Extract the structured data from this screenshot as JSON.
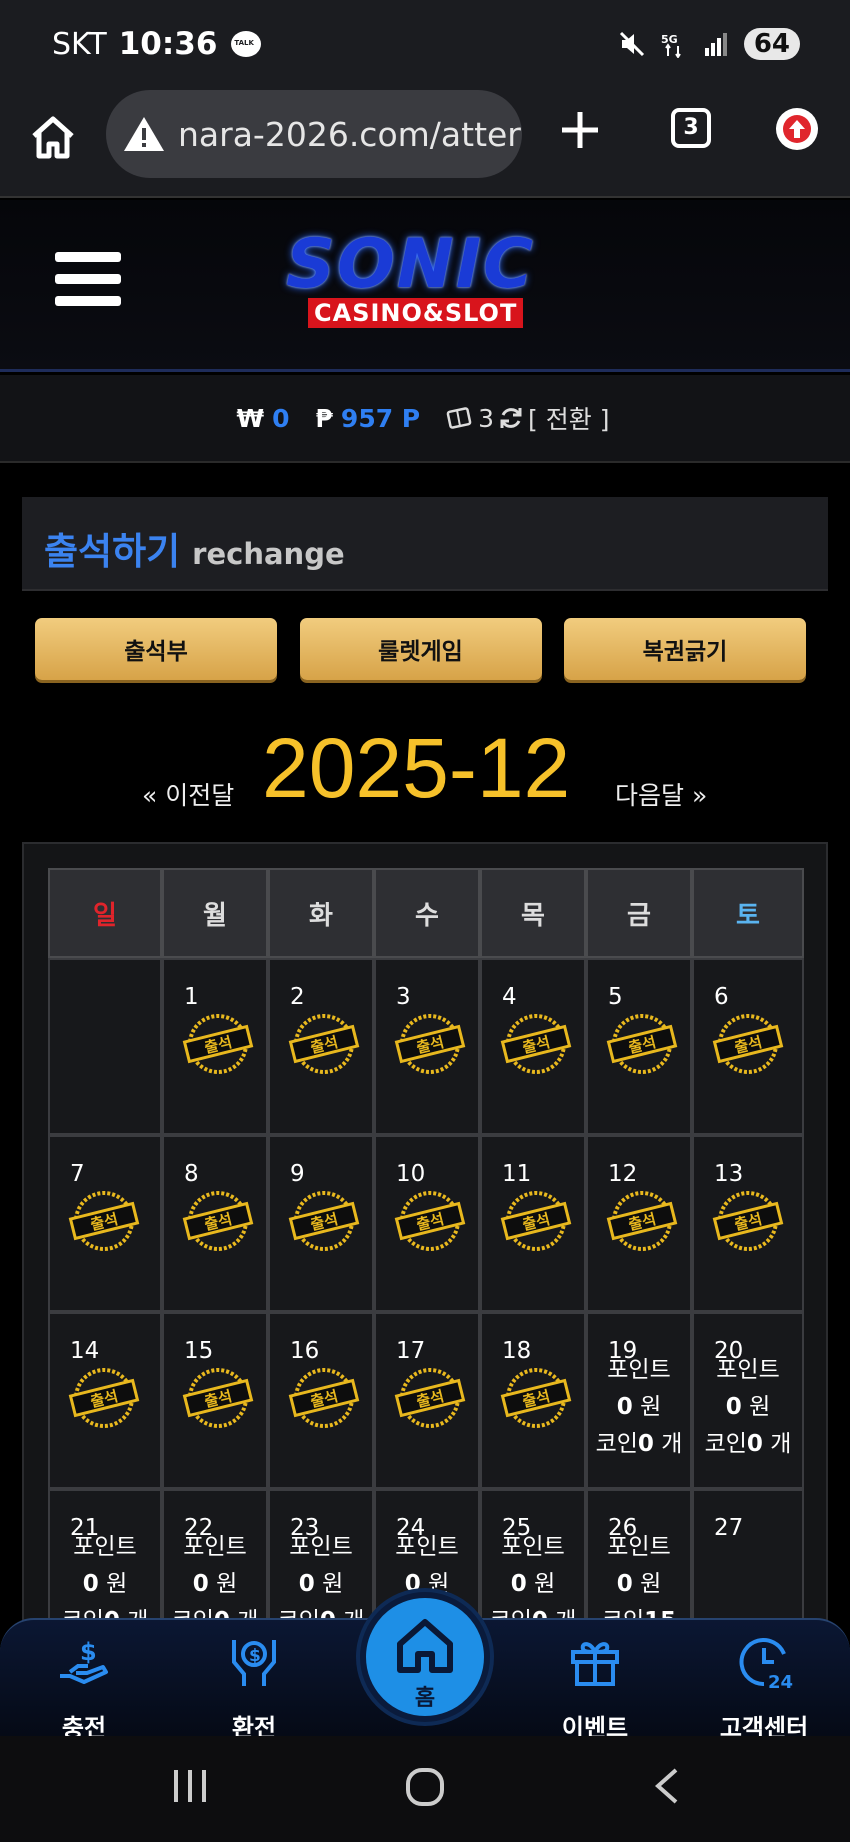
{
  "status_bar": {
    "carrier": "SKT",
    "time": "10:36",
    "battery": "64",
    "network": "5G"
  },
  "browser": {
    "url": "nara-2026.com/atter",
    "tab_count": "3"
  },
  "site": {
    "logo_main": "SONIC",
    "logo_sub": "CASINO&SLOT"
  },
  "balance": {
    "won_symbol": "₩",
    "won_value": "0",
    "point_symbol": "₱",
    "point_value": "957 P",
    "ticket_value": "3",
    "switch_label": "[ 전환 ]"
  },
  "page_title": {
    "main": "출석하기",
    "sub": "rechange"
  },
  "tab_buttons": [
    "출석부",
    "룰렛게임",
    "복권긁기"
  ],
  "month_nav": {
    "prev": "« 이전달",
    "current": "2025-12",
    "next": "다음달 »"
  },
  "calendar": {
    "weekdays": [
      "일",
      "월",
      "화",
      "수",
      "목",
      "금",
      "토"
    ],
    "weekday_colors": [
      "#e0242b",
      "#dddddd",
      "#dddddd",
      "#dddddd",
      "#dddddd",
      "#dddddd",
      "#5ab4f0"
    ],
    "stamp_label": "출석",
    "info_point_label": "포인트",
    "info_won_unit": "원",
    "info_coin_label": "코인",
    "info_coin_unit": "개",
    "weeks": [
      [
        {
          "day": ""
        },
        {
          "day": "1",
          "checked": true
        },
        {
          "day": "2",
          "checked": true
        },
        {
          "day": "3",
          "checked": true
        },
        {
          "day": "4",
          "checked": true
        },
        {
          "day": "5",
          "checked": true
        },
        {
          "day": "6",
          "checked": true
        }
      ],
      [
        {
          "day": "7",
          "checked": true
        },
        {
          "day": "8",
          "checked": true
        },
        {
          "day": "9",
          "checked": true
        },
        {
          "day": "10",
          "checked": true
        },
        {
          "day": "11",
          "checked": true
        },
        {
          "day": "12",
          "checked": true
        },
        {
          "day": "13",
          "checked": true
        }
      ],
      [
        {
          "day": "14",
          "checked": true
        },
        {
          "day": "15",
          "checked": true
        },
        {
          "day": "16",
          "checked": true
        },
        {
          "day": "17",
          "checked": true
        },
        {
          "day": "18",
          "checked": true
        },
        {
          "day": "19",
          "points": "0",
          "coins": "0"
        },
        {
          "day": "20",
          "points": "0",
          "coins": "0"
        }
      ],
      [
        {
          "day": "21",
          "points": "0",
          "coins": "0"
        },
        {
          "day": "22",
          "points": "0",
          "coins": "0"
        },
        {
          "day": "23",
          "points": "0",
          "coins": "0"
        },
        {
          "day": "24",
          "points": "0",
          "coins": "0"
        },
        {
          "day": "25",
          "points": "0",
          "coins": "0"
        },
        {
          "day": "26",
          "points": "0",
          "coins": "15"
        },
        {
          "day": "27"
        }
      ]
    ]
  },
  "bottom_nav": {
    "charge": "충전",
    "exchange": "환전",
    "home": "홈",
    "event": "이벤트",
    "support": "고객센터"
  },
  "colors": {
    "accent_blue": "#2f7ff2",
    "gold": "#f6c12a",
    "button_gold": "#e6b865"
  }
}
